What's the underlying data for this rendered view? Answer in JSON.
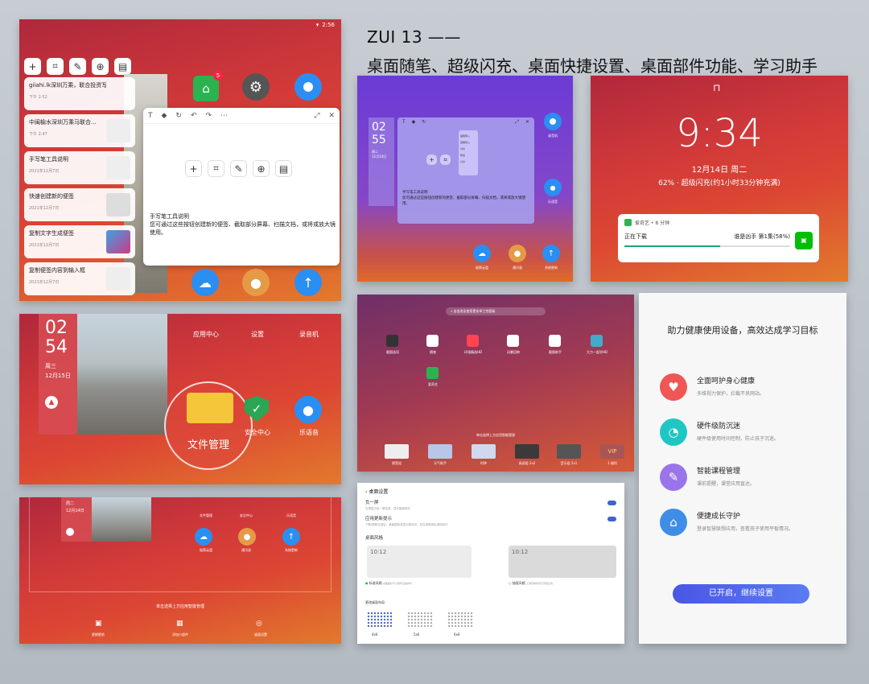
{
  "header": {
    "line1": "ZUI 13 ——",
    "line2": "桌面随笔、超级闪充、桌面快捷设置、桌面部件功能、学习助手"
  },
  "status": {
    "time": "2:56",
    "time2": "2:55"
  },
  "notes_panel": {
    "cards": [
      {
        "title": "giiahi.lk深圳万乘，联合投资写权有...",
        "date": "下午 2:52"
      },
      {
        "title": "中闽榆水深圳万乘马联合...",
        "date": "下午 2:47"
      },
      {
        "title": "手写笔工具说明",
        "date": "2021年12月7日"
      },
      {
        "title": "快速创建新的便签",
        "date": "2021年12月7日"
      },
      {
        "title": "复制文字生成便签",
        "date": "2021年12月7日"
      },
      {
        "title": "复制便签内容到输入框",
        "date": "2021年12月7日"
      }
    ],
    "note_title": "手写笔工具说明",
    "note_body": "您可通过这些按钮创建新的便签、截取部分屏幕、扫描文档，或将或放大镜使用。",
    "badge": "5"
  },
  "widget_panel": {
    "time_h": "02",
    "time_m": "54",
    "weekday": "周三",
    "date": "12月15日",
    "apps": [
      "应用中心",
      "设置",
      "录音机",
      "安全中心",
      "乐语音"
    ],
    "zoom_label": "文件管理"
  },
  "edit_panel": {
    "weekday": "周二",
    "date": "12月14日",
    "apps": [
      "文件管理",
      "安全中心",
      "乐语音",
      "极简云盘",
      "通讯录",
      "系统更新"
    ],
    "hint": "单击选择上方应用智能管理",
    "actions": [
      "更换壁纸",
      "添加小部件",
      "桌面设置"
    ]
  },
  "purple_panel": {
    "time_h": "02",
    "time_m": "55",
    "weekday": "周二",
    "date": "12月14日",
    "note_title": "手写笔工具说明",
    "note_body": "您可通过这些按钮创建新的便签、截取部分屏幕、扫描文档，或将或放大镜使用。",
    "menu": [
      "编辑导入",
      "复制导入",
      "分享",
      "导出",
      "分享"
    ],
    "dock": [
      "极简云盘",
      "通讯录",
      "系统更新"
    ],
    "apps": [
      "录音机",
      "乐语音"
    ]
  },
  "lock_panel": {
    "time": "9:34",
    "date": "12月14日 周二",
    "charge": "62% · 超级闪充(约1小时33分钟充满)",
    "app": "爱奇艺 • 8 分钟",
    "status": "正在下载",
    "title": "谁是凶手 第1集(58%)",
    "progress": 0.58
  },
  "drawer_panel": {
    "search": "自由进出使用更安卓工控面板",
    "apps": [
      "截图选项",
      "随笔",
      "环境精选HD",
      "风暴回映",
      "截图助手",
      "大力一起学HD",
      "爱奇艺"
    ],
    "hint": "单击选择上方应用智能管理",
    "widgets": [
      "便签组",
      "天气助手",
      "时钟",
      "阅读组 2x2",
      "音乐组 2x1",
      "1 福利"
    ]
  },
  "settings_panel": {
    "back": "桌面设置",
    "row1": "负一屏",
    "row1_sub": "右滑显示负一屏信息，显示智能助手",
    "row2": "应用更新提示",
    "row2_sub": "下载/更新应用后，桌面图标将显示新标识，在应用使用后消除标识",
    "section": "桌面风格",
    "clock": "10:12",
    "opt1": "标准风格",
    "opt1_sub": "桌面图标与小部件自由排列",
    "opt2": "抽屉风格",
    "opt2_sub": "上滑查看所有已安装应用",
    "section2": "更改桌面布局",
    "grids": [
      "4x6",
      "5x6",
      "6x6"
    ]
  },
  "assistant_panel": {
    "title": "助力健康使用设备，高效达成学习目标",
    "features": [
      {
        "name": "全面呵护身心健康",
        "desc": "多维视力保护，拦截不良网站。",
        "color": "#ee5755",
        "icon": "heart-icon"
      },
      {
        "name": "硬件级防沉迷",
        "desc": "硬件级使用时间控制，防止孩子沉迷。",
        "color": "#1ec6c4",
        "icon": "clock-icon"
      },
      {
        "name": "智能课程管理",
        "desc": "课前提醒，课堂应用直达。",
        "color": "#9a74ea",
        "icon": "wrench-icon"
      },
      {
        "name": "便捷成长守护",
        "desc": "登录智慧联想应用，查看孩子使用平板情况。",
        "color": "#3f8ee6",
        "icon": "home-icon"
      }
    ],
    "button": "已开启，继续设置"
  }
}
